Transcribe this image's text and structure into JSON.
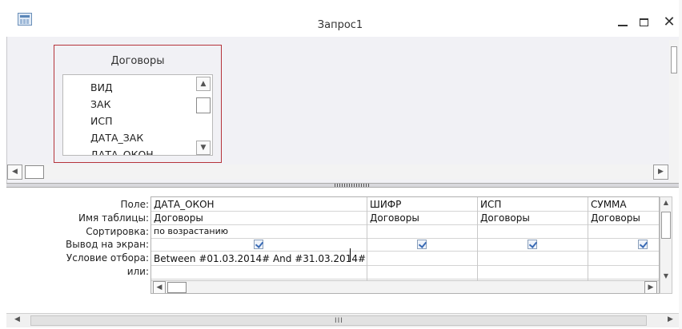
{
  "window": {
    "title": "Запрос1",
    "close_glyph": "✕"
  },
  "table": {
    "name": "Договоры",
    "fields": [
      "ВИД",
      "ЗАК",
      "ИСП",
      "ДАТА_ЗАК",
      "ДАТА_ОКОН"
    ]
  },
  "grid": {
    "row_labels": [
      "Поле:",
      "Имя таблицы:",
      "Сортировка:",
      "Вывод на экран:",
      "Условие отбора:",
      "или:"
    ],
    "columns": [
      {
        "field": "ДАТА_ОКОН",
        "table": "Договоры",
        "sort": "по возрастанию",
        "show": true,
        "criteria": "Between #01.03.2014# And #31.03.2014#",
        "or": ""
      },
      {
        "field": "ШИФР",
        "table": "Договоры",
        "sort": "",
        "show": true,
        "criteria": "",
        "or": ""
      },
      {
        "field": "ИСП",
        "table": "Договоры",
        "sort": "",
        "show": true,
        "criteria": "",
        "or": ""
      },
      {
        "field": "СУММА",
        "table": "Договоры",
        "sort": "",
        "show": true,
        "criteria": "",
        "or": ""
      }
    ]
  },
  "scroll": {
    "grip_glyph": "III"
  }
}
